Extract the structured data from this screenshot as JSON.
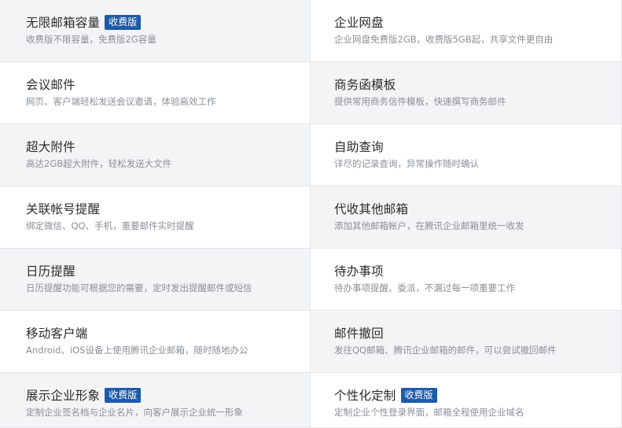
{
  "features": [
    [
      {
        "title": "无限邮箱容量",
        "badge": "收费版",
        "desc": "收费版不限容量，免费版2G容量"
      },
      {
        "title": "企业网盘",
        "badge": "",
        "desc": "企业网盘免费版2GB，收费版5GB起，共享文件更自由"
      }
    ],
    [
      {
        "title": "会议邮件",
        "badge": "",
        "desc": "网页、客户端轻松发送会议邀请，体验高效工作"
      },
      {
        "title": "商务函模板",
        "badge": "",
        "desc": "提供常用商务信件模板，快速撰写商务邮件"
      }
    ],
    [
      {
        "title": "超大附件",
        "badge": "",
        "desc": "高达2GB超大附件，轻松发送大文件"
      },
      {
        "title": "自助查询",
        "badge": "",
        "desc": "详尽的记录查询，异常操作随时确认"
      }
    ],
    [
      {
        "title": "关联帐号提醒",
        "badge": "",
        "desc": "绑定微信、QQ、手机，重要邮件实时提醒"
      },
      {
        "title": "代收其他邮箱",
        "badge": "",
        "desc": "添加其他邮箱帐户，在腾讯企业邮箱里统一收发"
      }
    ],
    [
      {
        "title": "日历提醒",
        "badge": "",
        "desc": "日历提醒功能可根据您的需要，定时发出提醒邮件或短信"
      },
      {
        "title": "待办事项",
        "badge": "",
        "desc": "待办事项提醒、委派，不漏过每一项重要工作"
      }
    ],
    [
      {
        "title": "移动客户端",
        "badge": "",
        "desc": "Android、iOS设备上使用腾讯企业邮箱，随时随地办公"
      },
      {
        "title": "邮件撤回",
        "badge": "",
        "desc": "发往QQ邮箱、腾讯企业邮箱的邮件，可以尝试撤回邮件"
      }
    ],
    [
      {
        "title": "展示企业形象",
        "badge": "收费版",
        "desc": "定制企业签名档与企业名片，向客户展示企业统一形象"
      },
      {
        "title": "个性化定制",
        "badge": "收费版",
        "desc": "定制企业个性登录界面，邮箱全程使用企业域名"
      }
    ]
  ],
  "colors": {
    "badge_bg": "#1e5aa8",
    "cell_gray": "#f3f4f6",
    "title": "#2b2b2b",
    "desc": "#8a8f96"
  }
}
